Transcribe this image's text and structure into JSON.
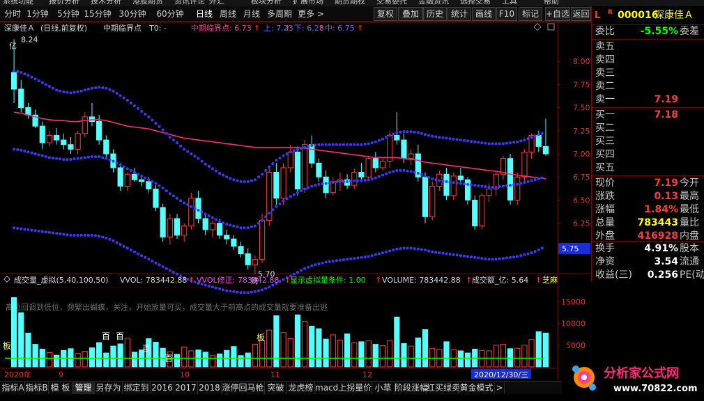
{
  "menu": [
    "系统功能",
    "报价分析",
    "技术分析",
    "港股期货",
    "资讯评论",
    "外汇",
    "板块分析",
    "扩展市场",
    "期货期权",
    "交易委托",
    "金融资讯",
    "选择交易",
    "工具",
    "帮助"
  ],
  "periods": [
    "分时",
    "1分钟",
    "5分钟",
    "15分钟",
    "30分钟",
    "60分钟",
    "日线",
    "周线",
    "月线",
    "多周期",
    "更多 >"
  ],
  "active_period": "日线",
  "tools": [
    "复权",
    "叠加",
    "历史",
    "统计",
    "画线",
    "F10",
    "标记",
    "+自选",
    "返回"
  ],
  "main_title": {
    "name": "深康佳Ａ",
    "mode": "(日线,前复权)",
    "indicator": "中期临界点",
    "t0": "T0: -",
    "critical_label": "中期临界点: 6.73",
    "upper": "上: 7.23",
    "lower": "下: 6.28",
    "mid": "中: 6.75",
    "arrow": "↑"
  },
  "annotations": {
    "high": "8.24",
    "high_tag": "亿",
    "low": "5.70",
    "low_tag": "财",
    "price_marker": "5.75",
    "baidu_tags": [
      "百",
      "百",
      "百",
      "百"
    ],
    "ban_tag": "板"
  },
  "chart_data": {
    "type": "candlestick",
    "ylim": [
      5.72,
      8.28
    ],
    "y_ticks": [
      8.0,
      7.75,
      7.5,
      7.25,
      7.0,
      6.75,
      6.5,
      6.25,
      6.0
    ],
    "ohlc": [
      [
        7.88,
        8.24,
        7.55,
        7.7
      ],
      [
        7.7,
        7.8,
        7.45,
        7.5
      ],
      [
        7.5,
        7.55,
        7.38,
        7.42
      ],
      [
        7.42,
        7.48,
        7.28,
        7.3
      ],
      [
        7.3,
        7.35,
        7.05,
        7.12
      ],
      [
        7.12,
        7.25,
        7.08,
        7.2
      ],
      [
        7.2,
        7.28,
        7.1,
        7.15
      ],
      [
        7.15,
        7.22,
        7.05,
        7.1
      ],
      [
        7.1,
        7.18,
        7.0,
        7.05
      ],
      [
        7.05,
        7.25,
        7.0,
        7.22
      ],
      [
        7.22,
        7.45,
        7.18,
        7.4
      ],
      [
        7.4,
        7.55,
        7.3,
        7.35
      ],
      [
        7.35,
        7.42,
        7.1,
        7.15
      ],
      [
        7.15,
        7.2,
        6.95,
        7.0
      ],
      [
        7.0,
        7.05,
        6.8,
        6.85
      ],
      [
        6.85,
        6.9,
        6.6,
        6.65
      ],
      [
        6.65,
        6.8,
        6.6,
        6.78
      ],
      [
        6.78,
        6.85,
        6.7,
        6.72
      ],
      [
        6.72,
        6.76,
        6.65,
        6.7
      ],
      [
        6.7,
        6.75,
        6.58,
        6.62
      ],
      [
        6.62,
        6.66,
        6.38,
        6.42
      ],
      [
        6.42,
        6.46,
        6.05,
        6.1
      ],
      [
        6.1,
        6.35,
        6.02,
        6.3
      ],
      [
        6.3,
        6.35,
        6.08,
        6.12
      ],
      [
        6.12,
        6.25,
        6.05,
        6.22
      ],
      [
        6.22,
        6.58,
        6.18,
        6.52
      ],
      [
        6.52,
        6.6,
        6.25,
        6.3
      ],
      [
        6.3,
        6.35,
        6.12,
        6.18
      ],
      [
        6.18,
        6.28,
        6.1,
        6.25
      ],
      [
        6.25,
        6.3,
        6.08,
        6.12
      ],
      [
        6.12,
        6.18,
        6.02,
        6.08
      ],
      [
        6.08,
        6.12,
        5.96,
        6.0
      ],
      [
        6.0,
        6.05,
        5.88,
        5.92
      ],
      [
        5.92,
        5.98,
        5.75,
        5.8
      ],
      [
        5.8,
        5.9,
        5.7,
        5.86
      ],
      [
        5.86,
        6.35,
        5.82,
        6.28
      ],
      [
        6.28,
        6.85,
        6.22,
        6.8
      ],
      [
        6.8,
        6.9,
        6.45,
        6.52
      ],
      [
        6.52,
        6.9,
        6.45,
        6.85
      ],
      [
        6.85,
        7.1,
        6.8,
        7.02
      ],
      [
        7.02,
        7.08,
        6.55,
        6.62
      ],
      [
        6.62,
        7.15,
        6.58,
        7.1
      ],
      [
        7.1,
        7.2,
        6.85,
        6.9
      ],
      [
        6.9,
        6.95,
        6.7,
        6.75
      ],
      [
        6.75,
        6.82,
        6.52,
        6.58
      ],
      [
        6.58,
        6.75,
        6.55,
        6.7
      ],
      [
        6.7,
        6.8,
        6.6,
        6.72
      ],
      [
        6.72,
        6.78,
        6.62,
        6.66
      ],
      [
        6.66,
        6.84,
        6.62,
        6.8
      ],
      [
        6.8,
        6.9,
        6.7,
        6.75
      ],
      [
        6.75,
        6.98,
        6.7,
        6.95
      ],
      [
        6.95,
        7.02,
        6.8,
        6.85
      ],
      [
        6.85,
        6.95,
        6.82,
        6.92
      ],
      [
        6.92,
        7.25,
        6.85,
        7.2
      ],
      [
        7.2,
        7.45,
        7.1,
        7.15
      ],
      [
        7.15,
        7.22,
        6.9,
        6.95
      ],
      [
        6.95,
        7.05,
        6.88,
        7.0
      ],
      [
        7.0,
        7.1,
        6.7,
        6.75
      ],
      [
        6.75,
        6.8,
        6.25,
        6.32
      ],
      [
        6.32,
        6.7,
        6.28,
        6.65
      ],
      [
        6.65,
        6.82,
        6.6,
        6.78
      ],
      [
        6.78,
        6.85,
        6.5,
        6.55
      ],
      [
        6.55,
        6.8,
        6.5,
        6.76
      ],
      [
        6.76,
        6.85,
        6.68,
        6.72
      ],
      [
        6.72,
        6.75,
        6.45,
        6.5
      ],
      [
        6.5,
        6.55,
        6.18,
        6.22
      ],
      [
        6.22,
        6.58,
        6.18,
        6.55
      ],
      [
        6.55,
        6.68,
        6.48,
        6.62
      ],
      [
        6.62,
        6.8,
        6.55,
        6.78
      ],
      [
        6.78,
        6.98,
        6.72,
        6.95
      ],
      [
        6.95,
        7.0,
        6.45,
        6.5
      ],
      [
        6.5,
        6.8,
        6.45,
        6.75
      ],
      [
        6.75,
        7.05,
        6.7,
        7.02
      ],
      [
        7.02,
        7.22,
        6.95,
        7.2
      ],
      [
        7.2,
        7.25,
        7.02,
        7.08
      ],
      [
        7.08,
        7.38,
        6.98,
        7.0
      ]
    ],
    "ma": [
      7.45,
      7.44,
      7.42,
      7.4,
      7.38,
      7.37,
      7.36,
      7.36,
      7.35,
      7.35,
      7.36,
      7.37,
      7.37,
      7.36,
      7.34,
      7.32,
      7.3,
      7.29,
      7.28,
      7.27,
      7.25,
      7.23,
      7.21,
      7.19,
      7.17,
      7.16,
      7.15,
      7.14,
      7.13,
      7.12,
      7.11,
      7.1,
      7.09,
      7.08,
      7.07,
      7.07,
      7.07,
      7.07,
      7.07,
      7.07,
      7.07,
      7.06,
      7.05,
      7.04,
      7.03,
      7.02,
      7.01,
      7.0,
      6.99,
      6.98,
      6.97,
      6.96,
      6.96,
      6.96,
      6.96,
      6.95,
      6.94,
      6.93,
      6.91,
      6.9,
      6.89,
      6.88,
      6.87,
      6.86,
      6.85,
      6.84,
      6.83,
      6.82,
      6.81,
      6.8,
      6.78,
      6.77,
      6.76,
      6.75,
      6.74,
      6.73
    ],
    "upper_band": [
      7.9,
      7.88,
      7.85,
      7.81,
      7.77,
      7.73,
      7.69,
      7.67,
      7.66,
      7.67,
      7.69,
      7.71,
      7.72,
      7.71,
      7.68,
      7.63,
      7.58,
      7.52,
      7.46,
      7.4,
      7.33,
      7.26,
      7.18,
      7.12,
      7.05,
      7.0,
      6.95,
      6.89,
      6.84,
      6.79,
      6.75,
      6.72,
      6.7,
      6.7,
      6.72,
      6.78,
      6.86,
      6.93,
      6.98,
      7.02,
      7.05,
      7.07,
      7.09,
      7.1,
      7.1,
      7.1,
      7.1,
      7.1,
      7.1,
      7.1,
      7.11,
      7.13,
      7.16,
      7.2,
      7.23,
      7.24,
      7.24,
      7.23,
      7.21,
      7.19,
      7.18,
      7.17,
      7.16,
      7.15,
      7.14,
      7.13,
      7.12,
      7.11,
      7.11,
      7.11,
      7.12,
      7.13,
      7.15,
      7.18,
      7.21,
      7.23
    ],
    "mid_band": [
      7.05,
      7.04,
      7.02,
      7.0,
      6.98,
      6.96,
      6.95,
      6.94,
      6.94,
      6.95,
      6.96,
      6.97,
      6.97,
      6.95,
      6.92,
      6.88,
      6.84,
      6.8,
      6.76,
      6.72,
      6.68,
      6.63,
      6.57,
      6.52,
      6.47,
      6.43,
      6.39,
      6.35,
      6.31,
      6.27,
      6.24,
      6.22,
      6.2,
      6.2,
      6.22,
      6.28,
      6.36,
      6.43,
      6.49,
      6.54,
      6.58,
      6.62,
      6.65,
      6.67,
      6.68,
      6.69,
      6.7,
      6.7,
      6.71,
      6.71,
      6.72,
      6.74,
      6.77,
      6.8,
      6.82,
      6.82,
      6.81,
      6.79,
      6.76,
      6.73,
      6.71,
      6.7,
      6.69,
      6.68,
      6.67,
      6.66,
      6.65,
      6.64,
      6.64,
      6.65,
      6.66,
      6.67,
      6.69,
      6.71,
      6.73,
      6.75
    ],
    "lower_band": [
      6.2,
      6.19,
      6.18,
      6.17,
      6.16,
      6.15,
      6.14,
      6.13,
      6.12,
      6.12,
      6.12,
      6.12,
      6.11,
      6.09,
      6.06,
      6.02,
      5.98,
      5.94,
      5.9,
      5.86,
      5.82,
      5.78,
      5.74,
      5.7,
      5.66,
      5.63,
      5.6,
      5.58,
      5.56,
      5.54,
      5.52,
      5.51,
      5.5,
      5.5,
      5.51,
      5.53,
      5.56,
      5.6,
      5.64,
      5.68,
      5.72,
      5.76,
      5.79,
      5.81,
      5.83,
      5.84,
      5.85,
      5.86,
      5.87,
      5.88,
      5.89,
      5.91,
      5.93,
      5.95,
      5.97,
      5.98,
      5.98,
      5.97,
      5.96,
      5.94,
      5.93,
      5.92,
      5.91,
      5.9,
      5.89,
      5.88,
      5.87,
      5.86,
      5.86,
      5.87,
      5.88,
      5.89,
      5.91,
      5.93,
      5.96,
      6.0
    ]
  },
  "volume_panel": {
    "title": "成交量_虚拟(5,40,100,50)",
    "vvol": "VVOL: 783442.88",
    "vvol_fix": "VVOL修正: 783442.88",
    "show_cond": "显示虚拟量条件: 1.00",
    "volume": "VOLUME: 783442.88",
    "amount": "成交额_亿: 5.64",
    "extra": "芝麻",
    "arrow": "↑",
    "note": "高位回调到低位，频繁出蝴蝶，关注，开始放量可买，成交量大于前高点的成交量就要准备出逃",
    "y_ticks": [
      15000,
      10000,
      5000
    ],
    "ylim": [
      0,
      17500
    ],
    "date_labels": [
      "2020年",
      "9",
      "10",
      "11",
      "12",
      "2020/12/30/三"
    ],
    "volumes": [
      16000,
      12500,
      7800,
      5200,
      4100,
      3300,
      2700,
      3800,
      4200,
      3100,
      3600,
      4400,
      5600,
      3200,
      4800,
      5300,
      6600,
      3400,
      3900,
      6500,
      5700,
      4300,
      3500,
      2900,
      4600,
      3700,
      3900,
      3400,
      2600,
      3000,
      3800,
      4700,
      2600,
      3200,
      5200,
      6000,
      8500,
      11800,
      7900,
      6500,
      12000,
      10500,
      9400,
      8800,
      6400,
      7400,
      6200,
      7600,
      5600,
      5800,
      6000,
      5200,
      4900,
      6100,
      11500,
      5400,
      4800,
      6700,
      8600,
      4300,
      4100,
      5800,
      4000,
      3700,
      3200,
      4100,
      3800,
      3700,
      5000,
      5200,
      4200,
      4300,
      5000,
      6300,
      8100,
      7800
    ],
    "ma_line": 2000
  },
  "quote": {
    "code": "000016",
    "name": "深康佳Ａ",
    "l": "L",
    "r": "R",
    "weibi": {
      "label": "委比",
      "value": "-5.55%",
      "right": "委差"
    },
    "sell": [
      {
        "label": "卖五",
        "value": ""
      },
      {
        "label": "卖四",
        "value": ""
      },
      {
        "label": "卖三",
        "value": ""
      },
      {
        "label": "卖二",
        "value": ""
      },
      {
        "label": "卖一",
        "value": "7.19"
      }
    ],
    "buy": [
      {
        "label": "买一",
        "value": "7.18"
      },
      {
        "label": "买二",
        "value": ""
      },
      {
        "label": "买三",
        "value": ""
      },
      {
        "label": "买四",
        "value": ""
      },
      {
        "label": "买五",
        "value": ""
      }
    ],
    "stats": [
      {
        "label": "现价",
        "value": "7.19",
        "right": "今开",
        "color": "#ff3b3b"
      },
      {
        "label": "涨跌",
        "value": "0.13",
        "right": "最高",
        "color": "#ff3b3b"
      },
      {
        "label": "涨幅",
        "value": "1.84%",
        "right": "最低",
        "color": "#ff3b3b"
      },
      {
        "label": "总量",
        "value": "783443",
        "right": "量比",
        "color": "#ffff00"
      },
      {
        "label": "外盘",
        "value": "416928",
        "right": "内盘",
        "color": "#ff3b3b"
      }
    ],
    "stats2": [
      {
        "label": "换手",
        "value": "4.91%",
        "right": "股本",
        "color": "#ffffff"
      },
      {
        "label": "净资",
        "value": "3.54",
        "right": "流通",
        "color": "#ffffff"
      },
      {
        "label": "收益(三)",
        "value": "0.256",
        "right": "PE(动",
        "color": "#ffffff"
      }
    ]
  },
  "tabs": [
    "指标A",
    "指标B",
    "模 板",
    "管理",
    "另存为",
    "绑定到",
    "2016",
    "2017",
    "2018",
    "涨停回马枪",
    "突破",
    "龙虎榜",
    "macd上拐量价",
    "小草",
    "阶段涨幅",
    "红买绿卖",
    "黄金模式",
    ">"
  ],
  "active_tab": "管理",
  "logo": {
    "title": "分析家公式网",
    "url": "www.70822.com"
  },
  "colors": {
    "up": "#ff3b3b",
    "down": "#54ffff",
    "band": "#3a3aff",
    "ma": "#ff2a7a",
    "volma": "#00ff00",
    "critical": "#ff3b9f"
  }
}
